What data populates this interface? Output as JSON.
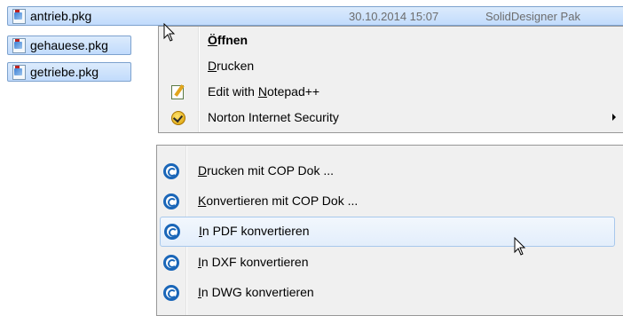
{
  "files": [
    {
      "name": "antrieb.pkg",
      "date": "30.10.2014 15:07",
      "type": "SolidDesigner Pak"
    },
    {
      "name": "gehauese.pkg"
    },
    {
      "name": "getriebe.pkg"
    }
  ],
  "context_menu": {
    "items": [
      {
        "pre": "",
        "key": "Ö",
        "post": "ffnen",
        "icon": null,
        "bold": true
      },
      {
        "pre": "",
        "key": "D",
        "post": "rucken",
        "icon": null
      },
      {
        "pre": "Edit with ",
        "key": "N",
        "post": "otepad++",
        "icon": "notepad-plus-plus-icon"
      },
      {
        "pre": "Norton Internet Security",
        "key": "",
        "post": "",
        "icon": "norton-icon",
        "submenu": true
      }
    ]
  },
  "cop_menu": {
    "items": [
      {
        "pre": "",
        "key": "D",
        "post": "rucken mit COP Dok ...",
        "icon": "cop-dok-icon"
      },
      {
        "pre": "",
        "key": "K",
        "post": "onvertieren mit COP Dok ...",
        "icon": "cop-dok-icon"
      },
      {
        "pre": "",
        "key": "I",
        "post": "n PDF konvertieren",
        "icon": "cop-dok-icon",
        "highlighted": true
      },
      {
        "pre": "",
        "key": "I",
        "post": "n DXF konvertieren",
        "icon": "cop-dok-icon"
      },
      {
        "pre": "",
        "key": "I",
        "post": "n DWG konvertieren",
        "icon": "cop-dok-icon"
      }
    ]
  },
  "colors": {
    "selection": "#cce0fa",
    "menu_bg": "#f0f0f0",
    "cop_blue": "#1a66b8"
  }
}
